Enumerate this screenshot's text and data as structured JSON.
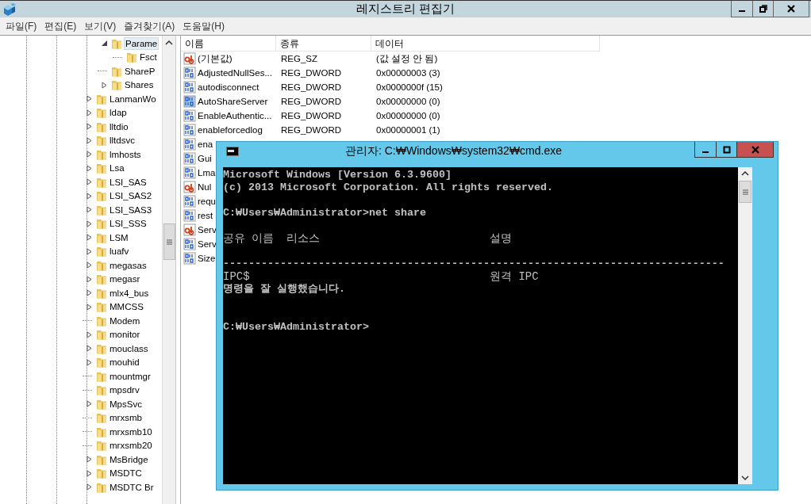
{
  "window": {
    "title": "레지스트리 편집기"
  },
  "menu": [
    "파일(F)",
    "편집(E)",
    "보기(V)",
    "즐겨찾기(A)",
    "도움말(H)"
  ],
  "tree": {
    "nested_items": [
      {
        "label": "Parame",
        "has_children": true,
        "expanded": true,
        "selected": true,
        "children": [
          {
            "label": "Fsct",
            "has_children": false,
            "selected": false
          }
        ]
      },
      {
        "label": "ShareP",
        "has_children": false,
        "selected": false
      },
      {
        "label": "Shares",
        "has_children": true,
        "expanded": false,
        "selected": false
      }
    ],
    "items": [
      {
        "label": "LanmanWo",
        "has_children": true,
        "expanded": false,
        "selected": false
      },
      {
        "label": "ldap",
        "has_children": true,
        "expanded": false,
        "selected": false
      },
      {
        "label": "lltdio",
        "has_children": true,
        "expanded": false,
        "selected": false
      },
      {
        "label": "lltdsvc",
        "has_children": true,
        "expanded": false,
        "selected": false
      },
      {
        "label": "lmhosts",
        "has_children": true,
        "expanded": false,
        "selected": false
      },
      {
        "label": "Lsa",
        "has_children": true,
        "expanded": false,
        "selected": false
      },
      {
        "label": "LSI_SAS",
        "has_children": true,
        "expanded": false,
        "selected": false
      },
      {
        "label": "LSI_SAS2",
        "has_children": true,
        "expanded": false,
        "selected": false
      },
      {
        "label": "LSI_SAS3",
        "has_children": true,
        "expanded": false,
        "selected": false
      },
      {
        "label": "LSI_SSS",
        "has_children": true,
        "expanded": false,
        "selected": false
      },
      {
        "label": "LSM",
        "has_children": true,
        "expanded": false,
        "selected": false
      },
      {
        "label": "luafv",
        "has_children": true,
        "expanded": false,
        "selected": false
      },
      {
        "label": "megasas",
        "has_children": true,
        "expanded": false,
        "selected": false
      },
      {
        "label": "megasr",
        "has_children": true,
        "expanded": false,
        "selected": false
      },
      {
        "label": "mlx4_bus",
        "has_children": true,
        "expanded": false,
        "selected": false
      },
      {
        "label": "MMCSS",
        "has_children": true,
        "expanded": false,
        "selected": false
      },
      {
        "label": "Modem",
        "has_children": false,
        "selected": false
      },
      {
        "label": "monitor",
        "has_children": true,
        "expanded": false,
        "selected": false
      },
      {
        "label": "mouclass",
        "has_children": true,
        "expanded": false,
        "selected": false
      },
      {
        "label": "mouhid",
        "has_children": true,
        "expanded": false,
        "selected": false
      },
      {
        "label": "mountmgr",
        "has_children": false,
        "selected": false
      },
      {
        "label": "mpsdrv",
        "has_children": false,
        "selected": false
      },
      {
        "label": "MpsSvc",
        "has_children": true,
        "expanded": false,
        "selected": false
      },
      {
        "label": "mrxsmb",
        "has_children": false,
        "selected": false
      },
      {
        "label": "mrxsmb10",
        "has_children": false,
        "selected": false
      },
      {
        "label": "mrxsmb20",
        "has_children": false,
        "selected": false
      },
      {
        "label": "MsBridge",
        "has_children": true,
        "expanded": false,
        "selected": false
      },
      {
        "label": "MSDTC",
        "has_children": true,
        "expanded": false,
        "selected": false
      },
      {
        "label": "MSDTC Br",
        "has_children": true,
        "expanded": false,
        "selected": false
      }
    ]
  },
  "values": {
    "columns": [
      "이름",
      "종류",
      "데이터"
    ],
    "rows": [
      {
        "kind": "string",
        "name": "(기본값)",
        "type": "REG_SZ",
        "data": "(값 설정 안 됨)",
        "selected": false
      },
      {
        "kind": "dword",
        "name": "AdjustedNullSes...",
        "type": "REG_DWORD",
        "data": "0x00000003 (3)",
        "selected": false
      },
      {
        "kind": "dword",
        "name": "autodisconnect",
        "type": "REG_DWORD",
        "data": "0x0000000f (15)",
        "selected": false
      },
      {
        "kind": "dword",
        "name": "AutoShareServer",
        "type": "REG_DWORD",
        "data": "0x00000000 (0)",
        "selected": true
      },
      {
        "kind": "dword",
        "name": "EnableAuthentic...",
        "type": "REG_DWORD",
        "data": "0x00000000 (0)",
        "selected": false
      },
      {
        "kind": "dword",
        "name": "enableforcedlog",
        "type": "REG_DWORD",
        "data": "0x00000001 (1)",
        "selected": false
      },
      {
        "kind": "dword",
        "name": "ena",
        "selected": false
      },
      {
        "kind": "dword",
        "name": "Gui",
        "selected": false
      },
      {
        "kind": "dword",
        "name": "Lma",
        "selected": false
      },
      {
        "kind": "string",
        "name": "Nul",
        "selected": false
      },
      {
        "kind": "dword",
        "name": "requ",
        "selected": false
      },
      {
        "kind": "dword",
        "name": "rest",
        "selected": false
      },
      {
        "kind": "string",
        "name": "Serv",
        "selected": false
      },
      {
        "kind": "dword",
        "name": "Serv",
        "selected": false
      },
      {
        "kind": "dword",
        "name": "Size",
        "selected": false
      }
    ]
  },
  "console": {
    "title": "관리자: C:₩Windows₩system32₩cmd.exe",
    "lines": [
      {
        "kind": "text",
        "text": "Microsoft Windows [Version 6.3.9600]"
      },
      {
        "kind": "text",
        "text": "(c) 2013 Microsoft Corporation. All rights reserved."
      },
      {
        "kind": "blank"
      },
      {
        "kind": "text",
        "text": "C:₩Users₩Administrator>net share"
      },
      {
        "kind": "blank"
      },
      {
        "kind": "columns",
        "name": "공유 이름",
        "resource": "리소스",
        "remark": "설명"
      },
      {
        "kind": "blank"
      },
      {
        "kind": "text",
        "text": "-------------------------------------------------------------------------------"
      },
      {
        "kind": "columns",
        "name": "IPC$",
        "remark": "원격 IPC"
      },
      {
        "kind": "text",
        "text": "명령을 잘 실행했습니다."
      },
      {
        "kind": "blank"
      },
      {
        "kind": "blank"
      },
      {
        "kind": "text",
        "text": "C:₩Users₩Administrator>"
      }
    ]
  }
}
